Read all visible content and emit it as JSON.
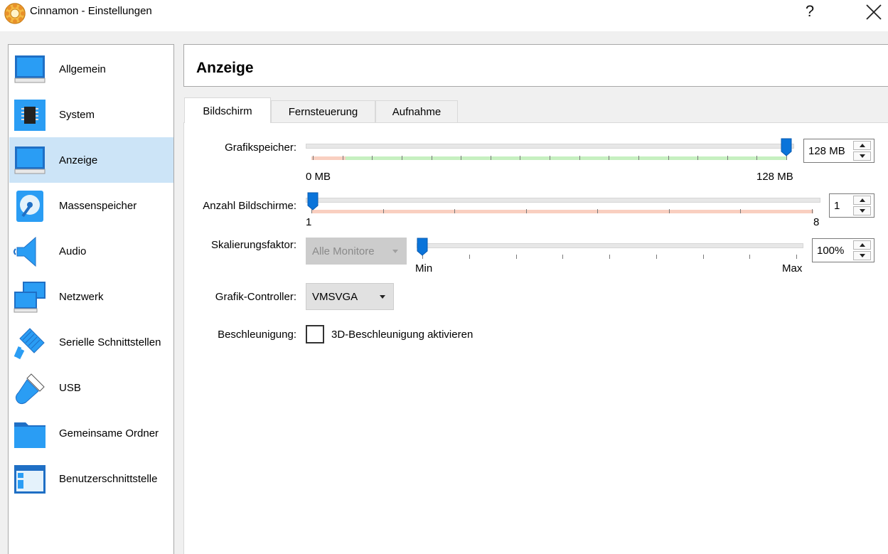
{
  "window": {
    "title": "Cinnamon - Einstellungen",
    "help": "?"
  },
  "sidebar": {
    "items": [
      {
        "label": "Allgemein",
        "icon": "monitor-general-icon"
      },
      {
        "label": "System",
        "icon": "chip-icon"
      },
      {
        "label": "Anzeige",
        "icon": "display-icon",
        "selected": true
      },
      {
        "label": "Massenspeicher",
        "icon": "storage-disk-icon"
      },
      {
        "label": "Audio",
        "icon": "speaker-icon"
      },
      {
        "label": "Netzwerk",
        "icon": "network-icon"
      },
      {
        "label": "Serielle Schnittstellen",
        "icon": "serial-port-icon"
      },
      {
        "label": "USB",
        "icon": "usb-icon"
      },
      {
        "label": "Gemeinsame Ordner",
        "icon": "shared-folder-icon"
      },
      {
        "label": "Benutzerschnittstelle",
        "icon": "user-interface-icon"
      }
    ]
  },
  "header": {
    "title": "Anzeige"
  },
  "tabs": [
    {
      "label": "Bildschirm",
      "active": true
    },
    {
      "label": "Fernsteuerung"
    },
    {
      "label": "Aufnahme"
    }
  ],
  "screen": {
    "video_memory": {
      "label": "Grafikspeicher:",
      "min_label": "0 MB",
      "max_label": "128 MB",
      "value": "128 MB",
      "position": 1.0
    },
    "monitor_count": {
      "label": "Anzahl Bildschirme:",
      "min_label": "1",
      "max_label": "8",
      "value": "1",
      "position": 0.0
    },
    "scale_factor": {
      "label": "Skalierungsfaktor:",
      "monitor_select": "Alle Monitore",
      "min_label": "Min",
      "max_label": "Max",
      "value": "100%",
      "position": 0.0
    },
    "graphics_controller": {
      "label": "Grafik-Controller:",
      "value": "VMSVGA"
    },
    "acceleration": {
      "label": "Beschleunigung:",
      "checkbox_label": "3D-Beschleunigung aktivieren",
      "checked": false
    }
  },
  "colors": {
    "accent": "#0a74da",
    "selected_bg": "#cce4f7",
    "slider_green": "#c6f0c0",
    "slider_red": "#f9cfc0"
  }
}
